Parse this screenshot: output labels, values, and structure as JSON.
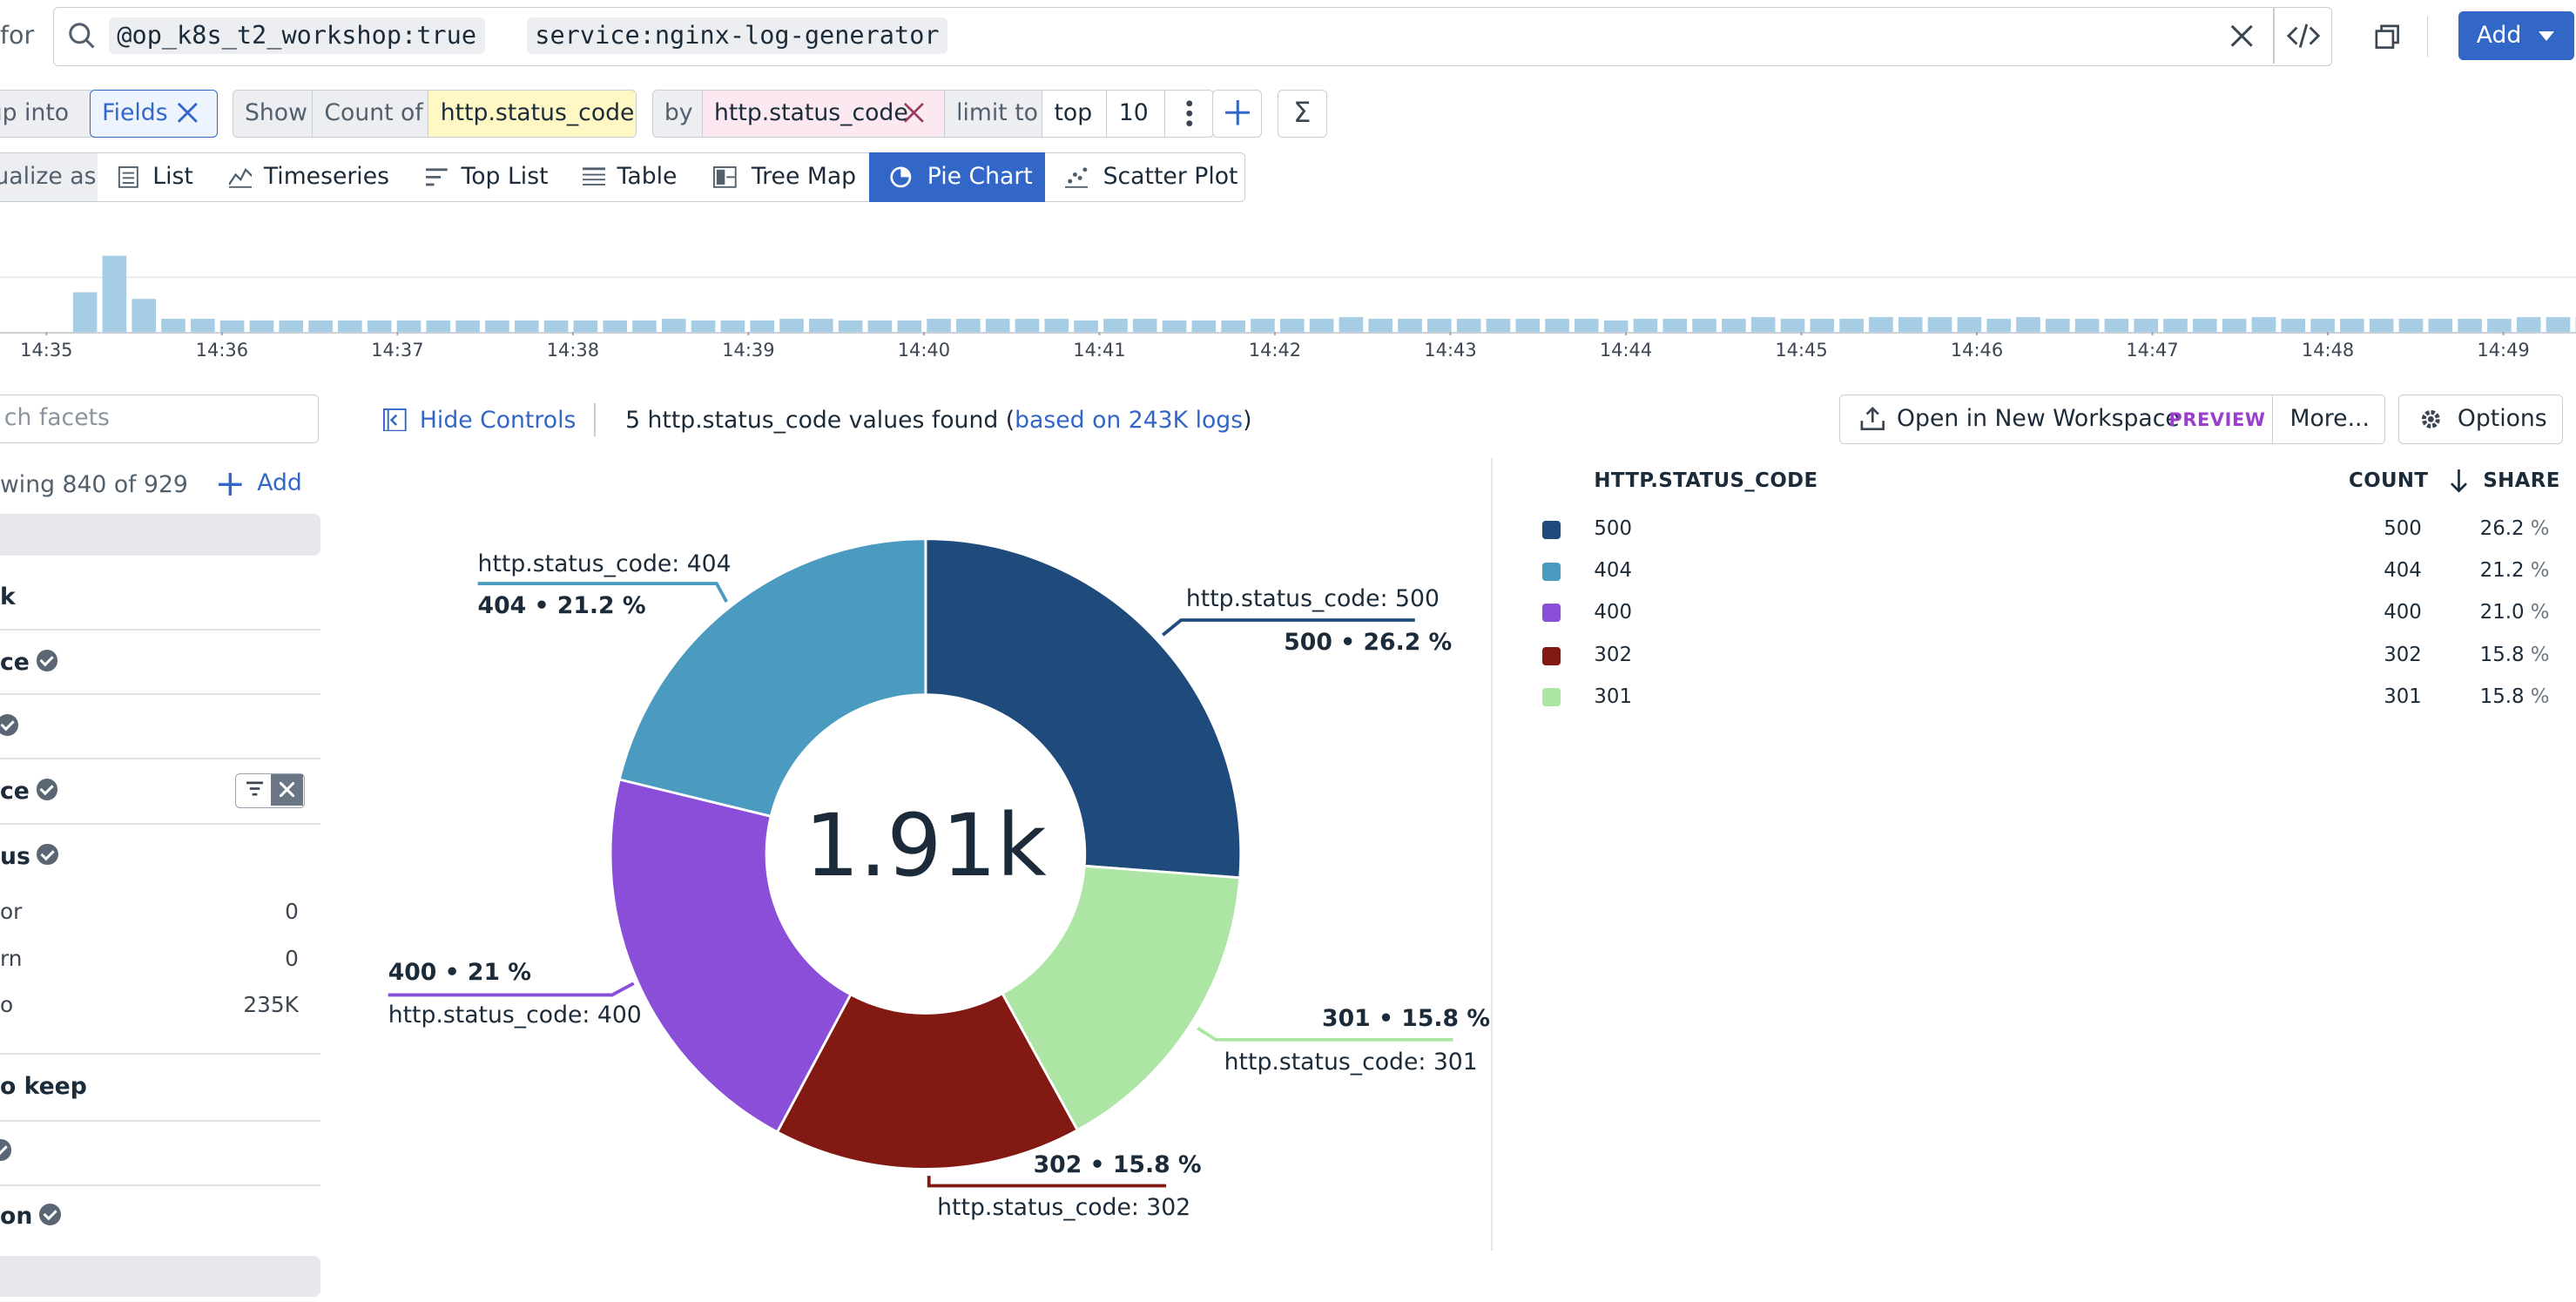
{
  "search": {
    "prefix": "for",
    "tokens": [
      {
        "key": "@op_k8s_t2_workshop",
        "value": "true"
      },
      {
        "key": "service",
        "value": "nginx-log-generator"
      }
    ]
  },
  "toolbar": {
    "add_label": "Add"
  },
  "query": {
    "group_into": "up into",
    "fields": "Fields",
    "show": "Show",
    "count_of": "Count of",
    "measure": "http.status_code",
    "by": "by",
    "group_by": "http.status_code",
    "limit_to": "limit to",
    "top": "top",
    "limit": "10"
  },
  "visualize": {
    "label": "ualize as",
    "tabs": [
      "List",
      "Timeseries",
      "Top List",
      "Table",
      "Tree Map",
      "Pie Chart",
      "Scatter Plot"
    ],
    "active": "Pie Chart"
  },
  "histogram": {
    "ticks": [
      "14:35",
      "14:36",
      "14:37",
      "14:38",
      "14:39",
      "14:40",
      "14:41",
      "14:42",
      "14:43",
      "14:44",
      "14:45",
      "14:46",
      "14:47",
      "14:48",
      "14:49"
    ],
    "bars": [
      24,
      46,
      20,
      8,
      8,
      7,
      7,
      7,
      7,
      7,
      7,
      7,
      7,
      7,
      7,
      7,
      7,
      7,
      7,
      7,
      8,
      7,
      7,
      7,
      8,
      8,
      7,
      7,
      7,
      8,
      8,
      8,
      8,
      8,
      7,
      8,
      8,
      7,
      7,
      7,
      8,
      8,
      8,
      9,
      8,
      8,
      8,
      8,
      8,
      8,
      8,
      8,
      7,
      8,
      8,
      8,
      8,
      9,
      8,
      8,
      8,
      9,
      9,
      9,
      9,
      8,
      9,
      8,
      8,
      8,
      8,
      8,
      8,
      8,
      9,
      8,
      8,
      8,
      8,
      8,
      8,
      8,
      8,
      9,
      9,
      9,
      8,
      8,
      8,
      8,
      8,
      8,
      8,
      8,
      9,
      8,
      8,
      8,
      8,
      9,
      8,
      8,
      9,
      8,
      8,
      9,
      9,
      9,
      8,
      8,
      8,
      8,
      9,
      9,
      9,
      8,
      8,
      8,
      8,
      8,
      8,
      8,
      8,
      8,
      8,
      8,
      7,
      8,
      8,
      9,
      8,
      8,
      8,
      8,
      8,
      8,
      8,
      8,
      8,
      8,
      8,
      8,
      8,
      8,
      8,
      8,
      8,
      8,
      8,
      8,
      8,
      8,
      8,
      8,
      8,
      8,
      8,
      8,
      8,
      8,
      8,
      8,
      8,
      8,
      8,
      8,
      8,
      8,
      8,
      8,
      8,
      8,
      8,
      8,
      8,
      8,
      8,
      8,
      7,
      4
    ]
  },
  "facets": {
    "search_placeholder": "ch facets",
    "showing": "wing 840 of 929",
    "add_label": "Add",
    "rows": [
      {
        "label": "k",
        "check": false
      },
      {
        "label": "ce",
        "check": true
      },
      {
        "label": "",
        "check": true
      },
      {
        "label": "ce",
        "check": true
      },
      {
        "label": "us",
        "check": true
      }
    ],
    "status_items": [
      {
        "label": "or",
        "count": "0"
      },
      {
        "label": "rn",
        "count": "0"
      },
      {
        "label": "o",
        "count": "235K"
      }
    ],
    "rows2": [
      {
        "label": "o keep",
        "check": false
      },
      {
        "label": "",
        "check": true
      },
      {
        "label": "on",
        "check": true
      }
    ]
  },
  "controls": {
    "hide_controls": "Hide Controls",
    "summary_prefix": "5 http.status_code values found (",
    "summary_link": "based on 243K logs",
    "summary_suffix": ")",
    "open_workspace": "Open in New Workspace",
    "preview": "PREVIEW",
    "more": "More...",
    "options": "Options"
  },
  "legend": {
    "col_code": "HTTP.STATUS_CODE",
    "col_count": "COUNT",
    "col_share": "SHARE",
    "rows": [
      {
        "code": "500",
        "count": "500",
        "share": "26.2",
        "pct": "%"
      },
      {
        "code": "404",
        "count": "404",
        "share": "21.2",
        "pct": "%"
      },
      {
        "code": "400",
        "count": "400",
        "share": "21.0",
        "pct": "%"
      },
      {
        "code": "302",
        "count": "302",
        "share": "15.8",
        "pct": "%"
      },
      {
        "code": "301",
        "count": "301",
        "share": "15.8",
        "pct": "%"
      }
    ]
  },
  "chart_data": {
    "type": "pie",
    "center_label": "1.91k",
    "categories": [
      "500",
      "301",
      "302",
      "400",
      "404"
    ],
    "values": [
      26.2,
      15.8,
      15.8,
      21.0,
      21.2
    ],
    "colors": [
      "#1f4a7c",
      "#ade5a5",
      "#821a13",
      "#8a4ed8",
      "#4a9bbf"
    ],
    "labels": [
      {
        "name": "http.status_code: 500",
        "value": "500 • 26.2 %"
      },
      {
        "name": "http.status_code: 301",
        "value": "301 • 15.8 %"
      },
      {
        "name": "http.status_code: 302",
        "value": "302 • 15.8 %"
      },
      {
        "name": "http.status_code: 400",
        "value": "400 • 21 %"
      },
      {
        "name": "http.status_code: 404",
        "value": "404 • 21.2 %"
      }
    ]
  }
}
